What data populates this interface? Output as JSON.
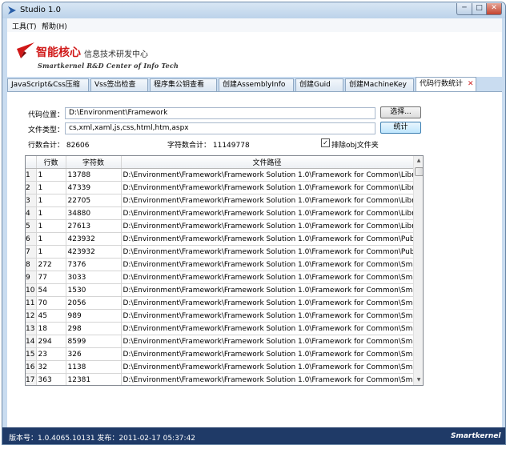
{
  "window": {
    "title": "Studio 1.0",
    "min_glyph": "─",
    "max_glyph": "□",
    "close_glyph": "✕"
  },
  "menu": [
    {
      "label": "工具(T)"
    },
    {
      "label": "帮助(H)"
    }
  ],
  "banner": {
    "title_cn": "智能核心",
    "subtitle_cn": "信息技术研发中心",
    "title_en": "Smartkernel R&D Center of Info Tech",
    "brand_color": "#d01818"
  },
  "tabs": [
    {
      "label": "JavaScript&Css压缩",
      "active": false
    },
    {
      "label": "Vss签出检查",
      "active": false
    },
    {
      "label": "程序集公钥查看",
      "active": false
    },
    {
      "label": "创建AssemblyInfo",
      "active": false
    },
    {
      "label": "创建Guid",
      "active": false
    },
    {
      "label": "创建MachineKey",
      "active": false
    },
    {
      "label": "代码行数统计",
      "active": true,
      "close_glyph": "✕"
    }
  ],
  "form": {
    "path_label": "代码位置：",
    "path_value": "D:\\Environment\\Framework",
    "browse_button": "选择...",
    "type_label": "文件类型：",
    "type_value": "cs,xml,xaml,js,css,html,htm,aspx",
    "count_button": "统计",
    "line_total": "行数合计：  82606",
    "char_total": "字符数合计：  11149778",
    "exclude_label": "排除obj文件夹",
    "exclude_checked": true,
    "check_glyph": "✓"
  },
  "grid": {
    "columns": [
      "行数",
      "字符数",
      "文件路径"
    ],
    "rows": [
      {
        "n": "1",
        "lines": "1",
        "chars": "13788",
        "path": "D:\\Environment\\Framework\\Framework Solution 1.0\\Framework for Common\\Library\\"
      },
      {
        "n": "2",
        "lines": "1",
        "chars": "47339",
        "path": "D:\\Environment\\Framework\\Framework Solution 1.0\\Framework for Common\\Library\\"
      },
      {
        "n": "3",
        "lines": "1",
        "chars": "22705",
        "path": "D:\\Environment\\Framework\\Framework Solution 1.0\\Framework for Common\\Library\\"
      },
      {
        "n": "4",
        "lines": "1",
        "chars": "34880",
        "path": "D:\\Environment\\Framework\\Framework Solution 1.0\\Framework for Common\\Library\\"
      },
      {
        "n": "5",
        "lines": "1",
        "chars": "27613",
        "path": "D:\\Environment\\Framework\\Framework Solution 1.0\\Framework for Common\\Library\\"
      },
      {
        "n": "6",
        "lines": "1",
        "chars": "423932",
        "path": "D:\\Environment\\Framework\\Framework Solution 1.0\\Framework for Common\\Publish\\"
      },
      {
        "n": "7",
        "lines": "1",
        "chars": "423932",
        "path": "D:\\Environment\\Framework\\Framework Solution 1.0\\Framework for Common\\Publish\\"
      },
      {
        "n": "8",
        "lines": "272",
        "chars": "7376",
        "path": "D:\\Environment\\Framework\\Framework Solution 1.0\\Framework for Common\\Smartk"
      },
      {
        "n": "9",
        "lines": "77",
        "chars": "3033",
        "path": "D:\\Environment\\Framework\\Framework Solution 1.0\\Framework for Common\\Smartk"
      },
      {
        "n": "10",
        "lines": "54",
        "chars": "1530",
        "path": "D:\\Environment\\Framework\\Framework Solution 1.0\\Framework for Common\\Smartk"
      },
      {
        "n": "11",
        "lines": "70",
        "chars": "2056",
        "path": "D:\\Environment\\Framework\\Framework Solution 1.0\\Framework for Common\\Smartk"
      },
      {
        "n": "12",
        "lines": "45",
        "chars": "989",
        "path": "D:\\Environment\\Framework\\Framework Solution 1.0\\Framework for Common\\Smartk"
      },
      {
        "n": "13",
        "lines": "18",
        "chars": "298",
        "path": "D:\\Environment\\Framework\\Framework Solution 1.0\\Framework for Common\\Smartk"
      },
      {
        "n": "14",
        "lines": "294",
        "chars": "8599",
        "path": "D:\\Environment\\Framework\\Framework Solution 1.0\\Framework for Common\\Smartk"
      },
      {
        "n": "15",
        "lines": "23",
        "chars": "326",
        "path": "D:\\Environment\\Framework\\Framework Solution 1.0\\Framework for Common\\Smartk"
      },
      {
        "n": "16",
        "lines": "32",
        "chars": "1138",
        "path": "D:\\Environment\\Framework\\Framework Solution 1.0\\Framework for Common\\Smartk"
      },
      {
        "n": "17",
        "lines": "363",
        "chars": "12381",
        "path": "D:\\Environment\\Framework\\Framework Solution 1.0\\Framework for Common\\Smartk"
      }
    ],
    "scroll_up_glyph": "▲",
    "scroll_down_glyph": "▼"
  },
  "status": {
    "version": "版本号：1.0.4065.10131  发布：2011-02-17 05:37:42",
    "brand": "Smartkernel",
    "bar_color": "#1f3a67"
  },
  "icons": {
    "app": "app-arrow-icon",
    "logo": "logo-arrow-icon",
    "checkbox": "check-icon"
  }
}
